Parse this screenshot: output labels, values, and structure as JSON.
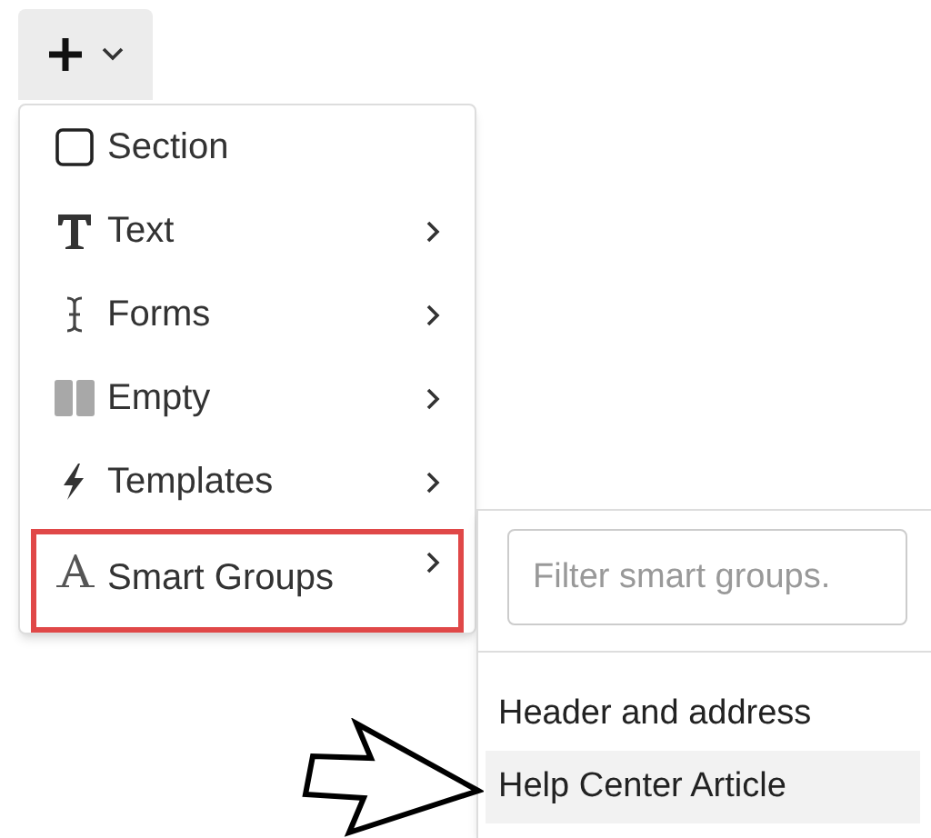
{
  "menu": {
    "items": [
      {
        "kind": "checkbox",
        "label": "Section",
        "submenu": false,
        "highlighted": false
      },
      {
        "kind": "text",
        "label": "Text",
        "submenu": true,
        "highlighted": false
      },
      {
        "kind": "cursor",
        "label": "Forms",
        "submenu": true,
        "highlighted": false
      },
      {
        "kind": "columns",
        "label": "Empty",
        "submenu": true,
        "highlighted": false
      },
      {
        "kind": "bolt",
        "label": "Templates",
        "submenu": true,
        "highlighted": false
      },
      {
        "kind": "letter",
        "label": "Smart Groups",
        "submenu": true,
        "highlighted": true
      }
    ]
  },
  "submenu": {
    "filter": {
      "placeholder": "Filter smart groups."
    },
    "items": [
      {
        "label": "Header and address",
        "selected": false
      },
      {
        "label": "Help Center Article",
        "selected": true
      }
    ]
  }
}
